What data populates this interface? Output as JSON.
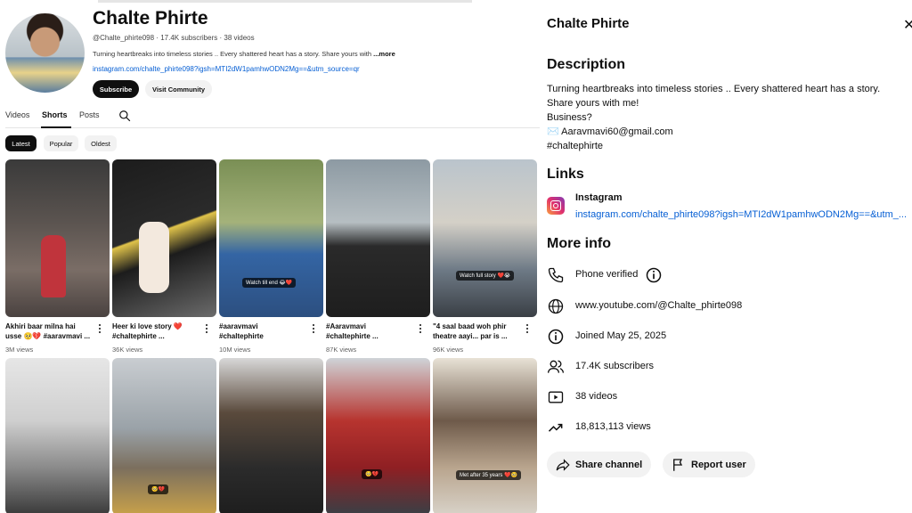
{
  "channel": {
    "name": "Chalte Phirte",
    "handle": "@Chalte_phirte098",
    "subscribers": "17.4K subscribers",
    "videos": "38 videos",
    "meta_separator": "·",
    "description_preview": "Turning heartbreaks into timeless stories .. Every shattered heart has a story. Share yours with",
    "more_label": "...more",
    "link": "instagram.com/chalte_phirte098?igsh=MTI2dW1pamhwODN2Mg==&utm_source=qr",
    "subscribe_label": "Subscribe",
    "community_label": "Visit Community"
  },
  "tabs": [
    {
      "label": "Videos",
      "active": false
    },
    {
      "label": "Shorts",
      "active": true
    },
    {
      "label": "Posts",
      "active": false
    }
  ],
  "chips": [
    {
      "label": "Latest",
      "active": true
    },
    {
      "label": "Popular",
      "active": false
    },
    {
      "label": "Oldest",
      "active": false
    }
  ],
  "shorts_row1": [
    {
      "title1": "Akhiri baar milna hai",
      "title2": "usse 🥺💔 #aaravmavi ...",
      "views": "3M views",
      "badge": ""
    },
    {
      "title1": "Heer ki love story ❤️",
      "title2": "#chaltephirte ...",
      "views": "36K views",
      "badge": ""
    },
    {
      "title1": "#aaravmavi",
      "title2": "#chaltephirte",
      "views": "10M views",
      "badge": "Watch till end 😂❤️"
    },
    {
      "title1": "#Aaravmavi",
      "title2": "#chaltephirte ...",
      "views": "87K views",
      "badge": ""
    },
    {
      "title1": "\"4 saal baad woh phir",
      "title2": "theatre aayi... par is ...",
      "views": "96K views",
      "badge": "Watch full story ❤️😭"
    }
  ],
  "shorts_row2": [
    {
      "badge": ""
    },
    {
      "badge": "🥺💔"
    },
    {
      "badge": ""
    },
    {
      "badge": "🥺💔"
    },
    {
      "badge": "Met after 35 years ❤️🥺"
    }
  ],
  "about": {
    "panel_title": "Chalte Phirte",
    "description_heading": "Description",
    "description_lines": [
      "Turning heartbreaks into timeless stories .. Every shattered heart has a story.",
      "Share yours with me!",
      "Business?",
      "✉️ Aaravmavi60@gmail.com",
      "#chaltephirte"
    ],
    "links_heading": "Links",
    "link_label": "Instagram",
    "link_url": "instagram.com/chalte_phirte098?igsh=MTI2dW1pamhwODN2Mg==&utm_...",
    "more_info_heading": "More info",
    "phone": "Phone verified",
    "website": "www.youtube.com/@Chalte_phirte098",
    "joined": "Joined May 25, 2025",
    "subscribers": "17.4K subscribers",
    "videos": "38 videos",
    "views": "18,813,113 views",
    "share_label": "Share channel",
    "report_label": "Report user"
  },
  "colors": {
    "link": "#065fd4",
    "text": "#0f0f0f",
    "chip_bg": "#f2f2f2",
    "secondary_text": "#606060"
  },
  "icons": [
    "search-icon",
    "close-icon",
    "instagram-icon",
    "phone-icon",
    "info-icon",
    "globe-icon",
    "people-icon",
    "play-icon",
    "trending-icon",
    "share-icon",
    "flag-icon",
    "more-vert-icon"
  ]
}
